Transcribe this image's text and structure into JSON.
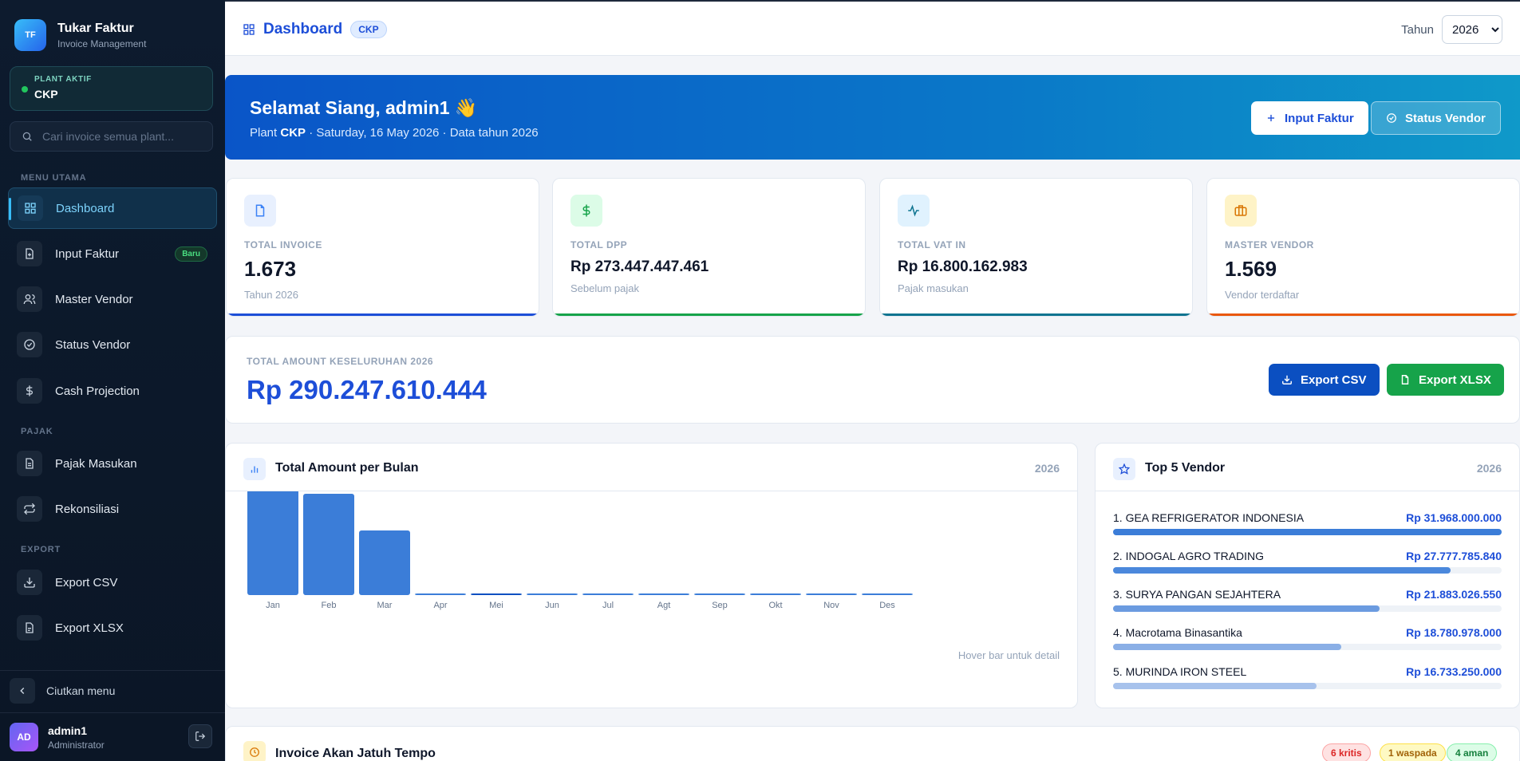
{
  "brand": {
    "name": "Tukar Faktur",
    "subtitle": "Invoice Management",
    "logo_text": "TF"
  },
  "plant": {
    "label": "PLANT AKTIF",
    "value": "CKP"
  },
  "search": {
    "placeholder": "Cari invoice semua plant..."
  },
  "sidebar": {
    "sections": {
      "main": "MENU UTAMA",
      "tax": "PAJAK",
      "export": "EXPORT"
    },
    "items": [
      {
        "label": "Dashboard",
        "icon": "grid-icon",
        "active": true
      },
      {
        "label": "Input Faktur",
        "icon": "file-plus-icon",
        "badge": "Baru"
      },
      {
        "label": "Master Vendor",
        "icon": "users-icon"
      },
      {
        "label": "Status Vendor",
        "icon": "check-circle-icon"
      },
      {
        "label": "Cash Projection",
        "icon": "dollar-icon"
      },
      {
        "label": "Pajak Masukan",
        "icon": "document-icon"
      },
      {
        "label": "Rekonsiliasi",
        "icon": "repeat-icon"
      },
      {
        "label": "Export CSV",
        "icon": "download-icon"
      },
      {
        "label": "Export XLSX",
        "icon": "file-text-icon"
      }
    ],
    "collapse_label": "Ciutkan menu"
  },
  "user": {
    "initials": "AD",
    "name": "admin1",
    "role": "Administrator"
  },
  "topbar": {
    "title": "Dashboard",
    "plant_chip": "CKP",
    "year_label": "Tahun",
    "year_value": "2026"
  },
  "hero": {
    "greeting": "Selamat Siang, admin1 👋",
    "plant_prefix": "Plant",
    "plant": "CKP",
    "date": "Saturday, 16 May 2026",
    "data_year": "Data tahun 2026",
    "btn_input": "Input Faktur",
    "btn_status": "Status Vendor"
  },
  "stats": [
    {
      "label": "TOTAL INVOICE",
      "value": "1.673",
      "sub": "Tahun 2026",
      "color": "#1d4ed8"
    },
    {
      "label": "TOTAL DPP",
      "value": "Rp 273.447.447.461",
      "sub": "Sebelum pajak",
      "color": "#16a34a"
    },
    {
      "label": "TOTAL VAT IN",
      "value": "Rp 16.800.162.983",
      "sub": "Pajak masukan",
      "color": "#0e7490"
    },
    {
      "label": "MASTER VENDOR",
      "value": "1.569",
      "sub": "Vendor terdaftar",
      "color": "#ea580c"
    }
  ],
  "total": {
    "label": "TOTAL AMOUNT KESELURUHAN 2026",
    "value": "Rp 290.247.610.444",
    "btn_csv": "Export CSV",
    "btn_xlsx": "Export XLSX"
  },
  "chart_panel": {
    "title": "Total Amount per Bulan",
    "year": "2026",
    "hint": "Hover bar untuk detail"
  },
  "chart_data": {
    "type": "bar",
    "categories": [
      "Jan",
      "Feb",
      "Mar",
      "Apr",
      "Mei",
      "Jun",
      "Jul",
      "Agt",
      "Sep",
      "Okt",
      "Nov",
      "Des"
    ],
    "values": [
      132,
      127,
      81,
      1,
      1.5,
      1,
      1,
      1,
      1,
      1,
      1,
      1
    ],
    "highlight": "Mei",
    "colors": {
      "bar": "#3b7dd8",
      "highlight": "#0b4fc1"
    }
  },
  "vendor_panel": {
    "title": "Top 5 Vendor",
    "year": "2026",
    "vendors": [
      {
        "name": "1. GEA REFRIGERATOR INDONESIA",
        "amount": "Rp 31.968.000.000",
        "share": 1.0
      },
      {
        "name": "2. INDOGAL AGRO TRADING",
        "amount": "Rp 27.777.785.840",
        "share": 0.869
      },
      {
        "name": "3. SURYA PANGAN SEJAHTERA",
        "amount": "Rp 21.883.026.550",
        "share": 0.685
      },
      {
        "name": "4. Macrotama Binasantika",
        "amount": "Rp 18.780.978.000",
        "share": 0.588
      },
      {
        "name": "5. MURINDA IRON STEEL",
        "amount": "Rp 16.733.250.000",
        "share": 0.523
      }
    ]
  },
  "due_panel": {
    "title": "Invoice Akan Jatuh Tempo",
    "critical": "6 kritis",
    "warning": "1 waspada",
    "safe": "4 aman"
  }
}
